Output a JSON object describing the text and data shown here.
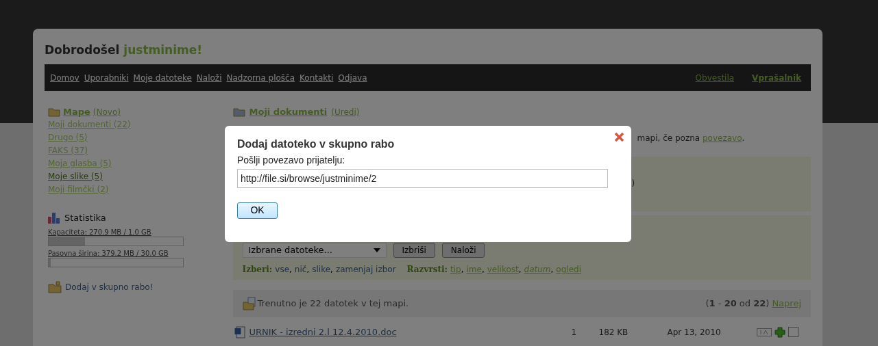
{
  "header": {
    "greeting": "Dobrodošel",
    "username": "justminime!"
  },
  "nav": {
    "left": [
      {
        "label": "Domov"
      },
      {
        "label": "Uporabniki"
      },
      {
        "label": "Moje datoteke"
      },
      {
        "label": "Naloži"
      },
      {
        "label": "Nadzorna plošča"
      },
      {
        "label": "Kontakti"
      },
      {
        "label": "Odjava"
      }
    ],
    "right": [
      {
        "label": "Obvestila",
        "bold": false
      },
      {
        "label": "Vprašalnik",
        "bold": true
      }
    ]
  },
  "sidebar": {
    "folders_title": "Mape",
    "new_link": "(Novo)",
    "folders": [
      {
        "label": "Moji dokumenti (22)",
        "selected": false
      },
      {
        "label": "Drugo (5)",
        "selected": false
      },
      {
        "label": "FAKS (37)",
        "selected": false
      },
      {
        "label": "Moja glasba (5)",
        "selected": false
      },
      {
        "label": "Moje slike (5)",
        "selected": true
      },
      {
        "label": "Moji filmčki (2)",
        "selected": false
      }
    ],
    "stats_title": "Statistika",
    "meters": [
      {
        "label": "Kapaciteta: 270.9 MB / 1.0 GB",
        "level": 0.27
      },
      {
        "label": "Pasovna širina: 379.2 MB / 30.0 GB",
        "level": 0.013
      }
    ],
    "share_link": "Dodaj v skupno rabo!"
  },
  "main": {
    "folder_title": "Moji dokumenti",
    "edit_link": "(Uredi)",
    "info_text": "mapi, če pozna",
    "info_link": "povezavo",
    "info_end": ".",
    "panel_fragment": ")",
    "bulk_select": "Izbrane datoteke...",
    "bulk_buttons": [
      "Izbriši",
      "Naloži"
    ],
    "separator": ",",
    "select_label": "Izberi:",
    "select_links": [
      "vse",
      "nič",
      "slike",
      "zamenjaj izbor"
    ],
    "sort_label": "Razvrsti:",
    "sort_links": [
      {
        "label": "tip",
        "selected": false
      },
      {
        "label": "ime",
        "selected": false
      },
      {
        "label": "velikost",
        "selected": false
      },
      {
        "label": "datum",
        "selected": true
      },
      {
        "label": "ogledi",
        "selected": false
      }
    ],
    "file_count_text": "Trenutno je 22 datotek v tej mapi.",
    "pagination": {
      "range": "(**1** - **20** od **22**)",
      "next": "Naprej"
    },
    "files": [
      {
        "name": "URNIK - izredni 2.l 12.4.2010.doc",
        "views": "1",
        "size": "182 KB",
        "date": "Apr 13, 2010",
        "checked": false
      }
    ]
  },
  "dialog": {
    "title": "Dodaj datoteko v skupno rabo",
    "label": "Pošlji povezavo prijatelju:",
    "value": "http://file.si/browse/justminime/2",
    "ok": "OK"
  }
}
